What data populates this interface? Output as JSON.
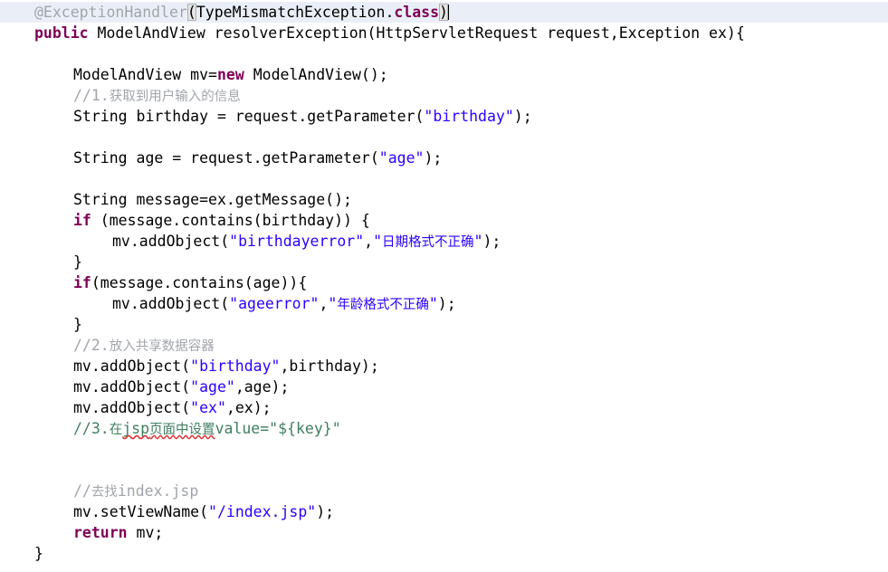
{
  "editor": {
    "language": "Java",
    "caret_line": 1,
    "colors": {
      "background": "#ffffff",
      "foreground": "#000000",
      "keyword": "#7f0055",
      "string": "#2a00ff",
      "comment_gray": "#a1a5ab",
      "comment_green": "#3f7f5f",
      "annotation": "#a1a5ab",
      "current_line_highlight": "#eaeff7",
      "bracket_match": "#e4e4e4",
      "spellcheck_underline": "#e03030"
    },
    "lines": [
      {
        "id": "line-annotation",
        "current": true,
        "indent": 0,
        "tokens": [
          {
            "t": "anno",
            "v": "@ExceptionHandler"
          },
          {
            "t": "brk",
            "v": "("
          },
          {
            "t": "plain",
            "v": "TypeMismatchException."
          },
          {
            "t": "kw",
            "v": "class"
          },
          {
            "t": "brk",
            "v": ")"
          },
          {
            "t": "caret",
            "v": ""
          }
        ]
      },
      {
        "id": "line-method-signature",
        "indent": 0,
        "tokens": [
          {
            "t": "kw",
            "v": "public"
          },
          {
            "t": "plain",
            "v": " ModelAndView resolverException(HttpServletRequest request,Exception ex){"
          }
        ]
      },
      {
        "id": "line-blank-1",
        "indent": 0,
        "tokens": []
      },
      {
        "id": "line-new-modelandview",
        "indent": 1,
        "tokens": [
          {
            "t": "plain",
            "v": "ModelAndView mv="
          },
          {
            "t": "kw",
            "v": "new"
          },
          {
            "t": "plain",
            "v": " ModelAndView();"
          }
        ]
      },
      {
        "id": "line-comment-1",
        "indent": 1,
        "tokens": [
          {
            "t": "cmt",
            "v": "//1."
          },
          {
            "t": "cmt-cjk",
            "v": "获取到用户输入的信息"
          }
        ]
      },
      {
        "id": "line-get-birthday",
        "indent": 1,
        "tokens": [
          {
            "t": "plain",
            "v": "String birthday = request.getParameter("
          },
          {
            "t": "str",
            "v": "\"birthday\""
          },
          {
            "t": "plain",
            "v": ");"
          }
        ]
      },
      {
        "id": "line-blank-2",
        "indent": 0,
        "tokens": []
      },
      {
        "id": "line-get-age",
        "indent": 1,
        "tokens": [
          {
            "t": "plain",
            "v": "String age = request.getParameter("
          },
          {
            "t": "str",
            "v": "\"age\""
          },
          {
            "t": "plain",
            "v": ");"
          }
        ]
      },
      {
        "id": "line-blank-3",
        "indent": 0,
        "tokens": []
      },
      {
        "id": "line-get-message",
        "indent": 1,
        "tokens": [
          {
            "t": "plain",
            "v": "String message=ex.getMessage();"
          }
        ]
      },
      {
        "id": "line-if-birthday",
        "indent": 1,
        "tokens": [
          {
            "t": "kw",
            "v": "if"
          },
          {
            "t": "plain",
            "v": " (message.contains(birthday)) {"
          }
        ]
      },
      {
        "id": "line-add-birthdayerror",
        "indent": 2,
        "tokens": [
          {
            "t": "plain",
            "v": "mv.addObject("
          },
          {
            "t": "str",
            "v": "\"birthdayerror\""
          },
          {
            "t": "plain",
            "v": ","
          },
          {
            "t": "str",
            "v": "\""
          },
          {
            "t": "str-cjk",
            "v": "日期格式不正确"
          },
          {
            "t": "str",
            "v": "\""
          },
          {
            "t": "plain",
            "v": ");"
          }
        ]
      },
      {
        "id": "line-close-if-birthday",
        "indent": 1,
        "tokens": [
          {
            "t": "plain",
            "v": "}"
          }
        ]
      },
      {
        "id": "line-if-age",
        "indent": 1,
        "tokens": [
          {
            "t": "kw",
            "v": "if"
          },
          {
            "t": "plain",
            "v": "(message.contains(age)){"
          }
        ]
      },
      {
        "id": "line-add-ageerror",
        "indent": 2,
        "tokens": [
          {
            "t": "plain",
            "v": "mv.addObject("
          },
          {
            "t": "str",
            "v": "\"ageerror\""
          },
          {
            "t": "plain",
            "v": ","
          },
          {
            "t": "str",
            "v": "\""
          },
          {
            "t": "str-cjk",
            "v": "年龄格式不正确"
          },
          {
            "t": "str",
            "v": "\""
          },
          {
            "t": "plain",
            "v": ");"
          }
        ]
      },
      {
        "id": "line-close-if-age",
        "indent": 1,
        "tokens": [
          {
            "t": "plain",
            "v": "}"
          }
        ]
      },
      {
        "id": "line-comment-2",
        "indent": 1,
        "tokens": [
          {
            "t": "cmt",
            "v": "//2."
          },
          {
            "t": "cmt-cjk",
            "v": "放入共享数据容器"
          }
        ]
      },
      {
        "id": "line-add-birthday",
        "indent": 1,
        "tokens": [
          {
            "t": "plain",
            "v": "mv.addObject("
          },
          {
            "t": "str",
            "v": "\"birthday\""
          },
          {
            "t": "plain",
            "v": ",birthday);"
          }
        ]
      },
      {
        "id": "line-add-age",
        "indent": 1,
        "tokens": [
          {
            "t": "plain",
            "v": "mv.addObject("
          },
          {
            "t": "str",
            "v": "\"age\""
          },
          {
            "t": "plain",
            "v": ",age);"
          }
        ]
      },
      {
        "id": "line-add-ex",
        "indent": 1,
        "tokens": [
          {
            "t": "plain",
            "v": "mv.addObject("
          },
          {
            "t": "str",
            "v": "\"ex\""
          },
          {
            "t": "plain",
            "v": ",ex);"
          }
        ]
      },
      {
        "id": "line-comment-3",
        "indent": 1,
        "tokens": [
          {
            "t": "cmt-green",
            "v": "//3."
          },
          {
            "t": "cmt-green-cjk",
            "v": "在"
          },
          {
            "t": "cmt-green-spell",
            "v": "jsp"
          },
          {
            "t": "cmt-green-cjk-spell",
            "v": "页面中设置"
          },
          {
            "t": "cmt-green",
            "v": "value=\"${key}\""
          }
        ]
      },
      {
        "id": "line-blank-4",
        "indent": 0,
        "tokens": []
      },
      {
        "id": "line-blank-5",
        "indent": 0,
        "tokens": []
      },
      {
        "id": "line-comment-4",
        "indent": 1,
        "tokens": [
          {
            "t": "cmt",
            "v": "//"
          },
          {
            "t": "cmt-cjk",
            "v": "去找"
          },
          {
            "t": "cmt",
            "v": "index.jsp"
          }
        ]
      },
      {
        "id": "line-setviewname",
        "indent": 1,
        "tokens": [
          {
            "t": "plain",
            "v": "mv.setViewName("
          },
          {
            "t": "str",
            "v": "\"/index.jsp\""
          },
          {
            "t": "plain",
            "v": ");"
          }
        ]
      },
      {
        "id": "line-return",
        "indent": 1,
        "tokens": [
          {
            "t": "kw",
            "v": "return"
          },
          {
            "t": "plain",
            "v": " mv;"
          }
        ]
      },
      {
        "id": "line-close-method",
        "indent": 0,
        "tokens": [
          {
            "t": "plain",
            "v": "}"
          }
        ]
      }
    ]
  }
}
